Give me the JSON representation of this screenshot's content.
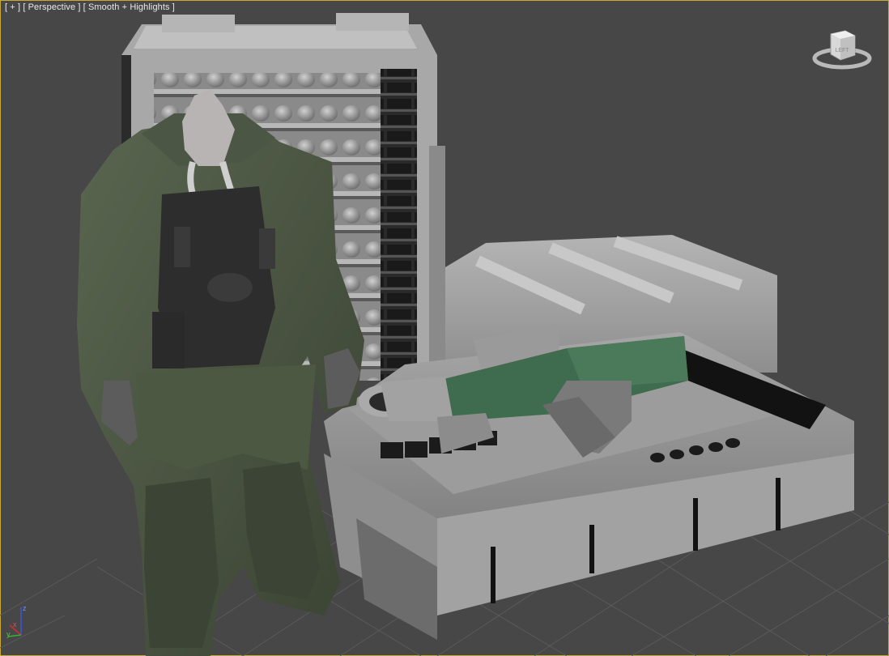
{
  "viewport": {
    "label_plus": "[ + ]",
    "label_view": "[ Perspective ]",
    "label_shading": "[ Smooth + Highlights ]",
    "background_color": "#474747",
    "border_color": "#c9a83a"
  },
  "viewcube": {
    "face_label": "LEFT",
    "icon": "viewcube-icon"
  },
  "axis_tripod": {
    "z_label": "z",
    "x_label": "x",
    "y_label": "y"
  },
  "scene_objects": [
    {
      "name": "soldier-character",
      "color": "#4b5540"
    },
    {
      "name": "ammo-rack",
      "color": "#9a9a9a"
    },
    {
      "name": "weapon-crate",
      "color": "#a0a0a0"
    },
    {
      "name": "bazooka-weapon",
      "color": "#3f6b4f"
    },
    {
      "name": "ground-grid",
      "color": "#575757"
    }
  ]
}
